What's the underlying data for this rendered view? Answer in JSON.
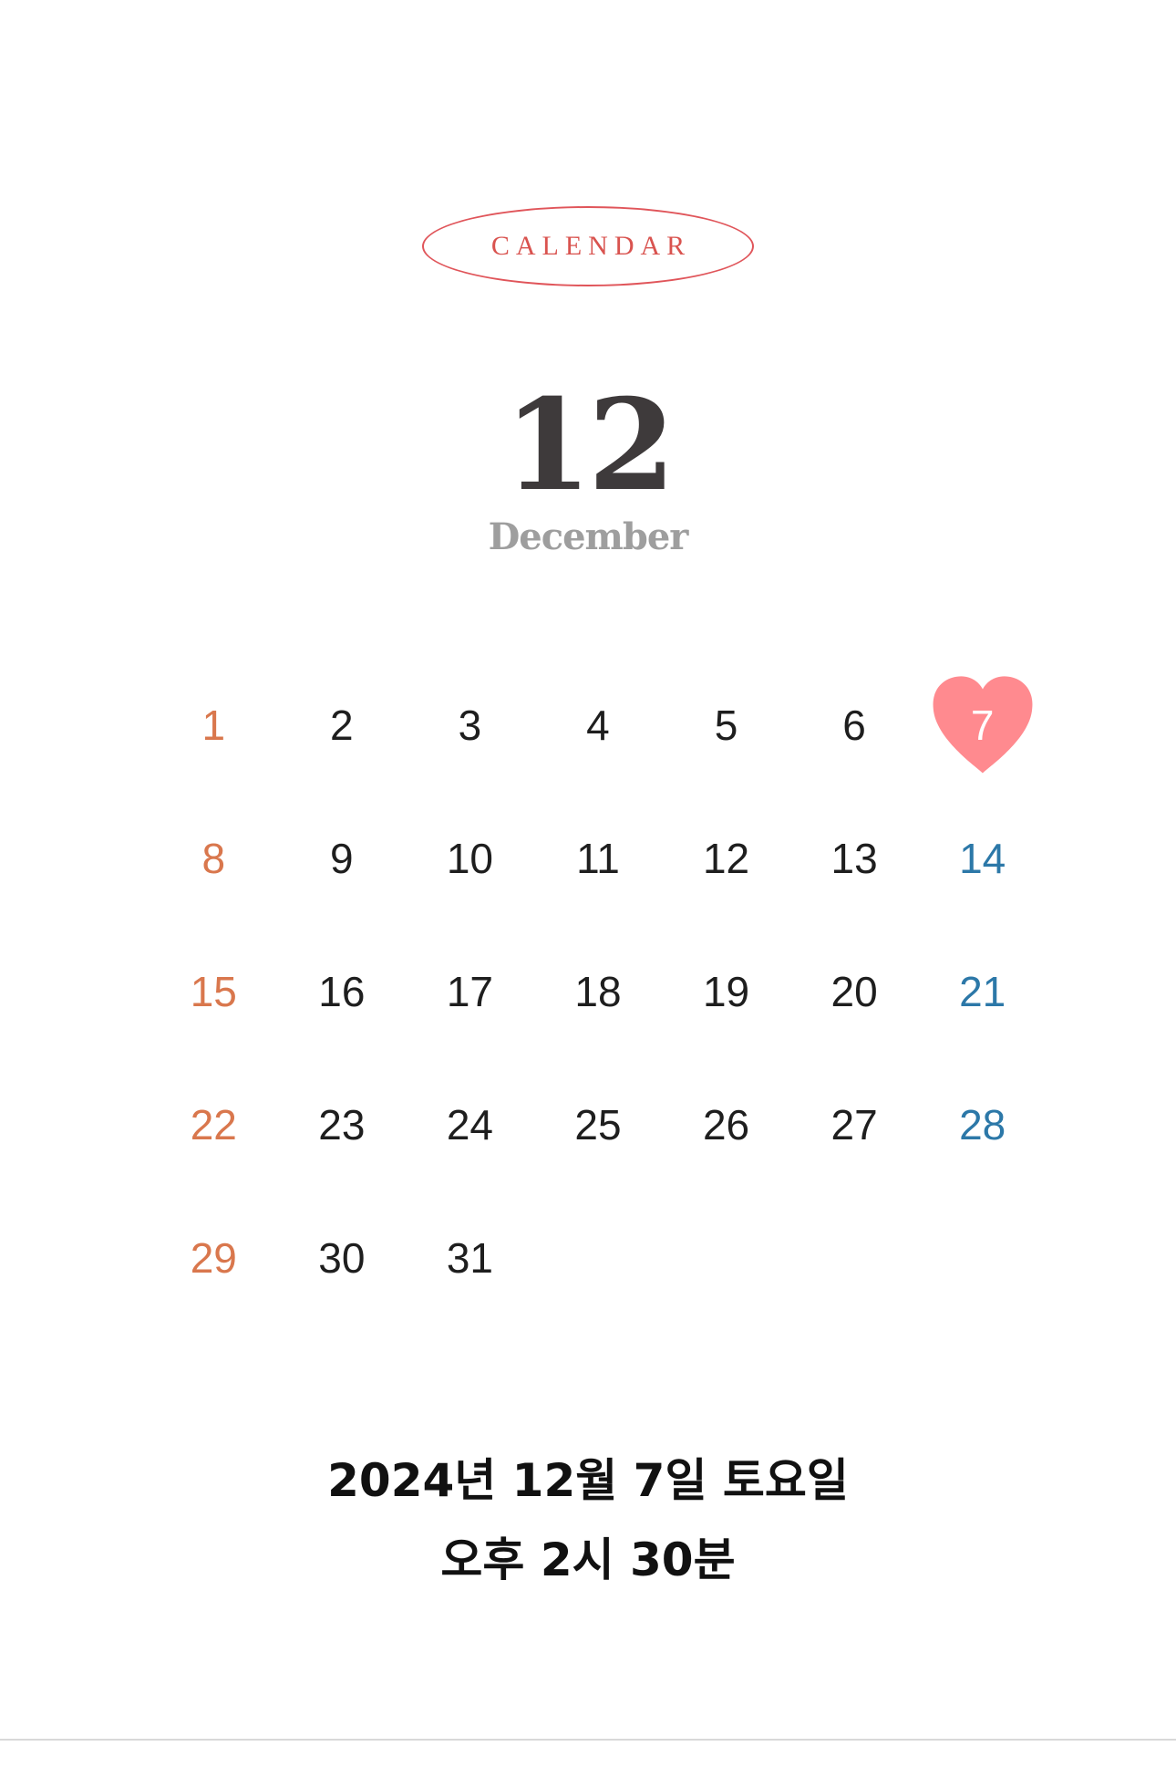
{
  "header": {
    "label": "CALENDAR",
    "accent_color": "#e0555a"
  },
  "month": {
    "number": "12",
    "name": "December"
  },
  "calendar": {
    "today": "7",
    "highlight_icon": "heart-icon",
    "highlight_color": "#ff8a8f",
    "sunday_color": "#d9774d",
    "saturday_color": "#2c78a8",
    "weeks": [
      [
        "1",
        "2",
        "3",
        "4",
        "5",
        "6",
        "7"
      ],
      [
        "8",
        "9",
        "10",
        "11",
        "12",
        "13",
        "14"
      ],
      [
        "15",
        "16",
        "17",
        "18",
        "19",
        "20",
        "21"
      ],
      [
        "22",
        "23",
        "24",
        "25",
        "26",
        "27",
        "28"
      ],
      [
        "29",
        "30",
        "31",
        "",
        "",
        "",
        ""
      ]
    ]
  },
  "footer": {
    "date": "2024년 12월 7일 토요일",
    "time": "오후 2시 30분"
  }
}
